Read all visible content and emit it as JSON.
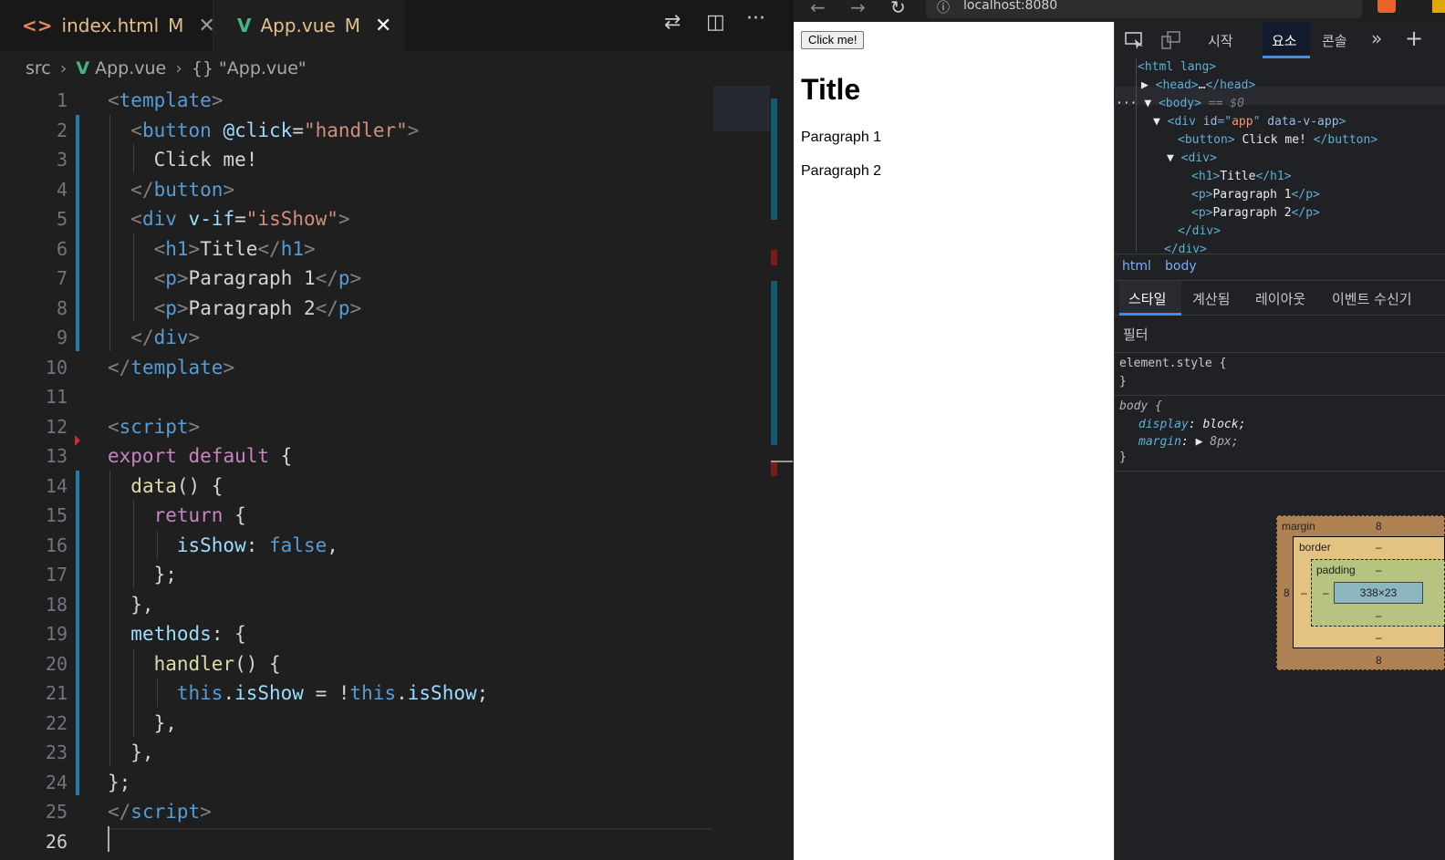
{
  "editor": {
    "tabs": [
      {
        "icon": "<>",
        "name": "index.html",
        "status": "M",
        "close": "✕"
      },
      {
        "icon": "V",
        "name": "App.vue",
        "status": "M",
        "close": "✕"
      }
    ],
    "actions": {
      "compare": "⇄",
      "split": "◫",
      "more": "···"
    },
    "breadcrumb": {
      "folder": "src",
      "file": "App.vue",
      "symbol_icon": "{}",
      "symbol": "\"App.vue\""
    },
    "line_numbers": [
      "1",
      "2",
      "3",
      "4",
      "5",
      "6",
      "7",
      "8",
      "9",
      "10",
      "11",
      "12",
      "13",
      "14",
      "15",
      "16",
      "17",
      "18",
      "19",
      "20",
      "21",
      "22",
      "23",
      "24",
      "25",
      "26"
    ],
    "code": [
      [
        {
          "t": "<",
          "c": "#808080"
        },
        {
          "t": "template",
          "c": "#569cd6"
        },
        {
          "t": ">",
          "c": "#808080"
        }
      ],
      [
        {
          "t": "  "
        },
        {
          "t": "<",
          "c": "#808080"
        },
        {
          "t": "button",
          "c": "#569cd6"
        },
        {
          "t": " "
        },
        {
          "t": "@click",
          "c": "#9cdcfe"
        },
        {
          "t": "=",
          "c": "#d4d4d4"
        },
        {
          "t": "\"handler\"",
          "c": "#ce9178"
        },
        {
          "t": ">",
          "c": "#808080"
        }
      ],
      [
        {
          "t": "    Click me!",
          "c": "#d4d4d4"
        }
      ],
      [
        {
          "t": "  "
        },
        {
          "t": "</",
          "c": "#808080"
        },
        {
          "t": "button",
          "c": "#569cd6"
        },
        {
          "t": ">",
          "c": "#808080"
        }
      ],
      [
        {
          "t": "  "
        },
        {
          "t": "<",
          "c": "#808080"
        },
        {
          "t": "div",
          "c": "#569cd6"
        },
        {
          "t": " "
        },
        {
          "t": "v-if",
          "c": "#9cdcfe"
        },
        {
          "t": "=",
          "c": "#d4d4d4"
        },
        {
          "t": "\"isShow\"",
          "c": "#ce9178"
        },
        {
          "t": ">",
          "c": "#808080"
        }
      ],
      [
        {
          "t": "    "
        },
        {
          "t": "<",
          "c": "#808080"
        },
        {
          "t": "h1",
          "c": "#569cd6"
        },
        {
          "t": ">",
          "c": "#808080"
        },
        {
          "t": "Title",
          "c": "#d4d4d4"
        },
        {
          "t": "</",
          "c": "#808080"
        },
        {
          "t": "h1",
          "c": "#569cd6"
        },
        {
          "t": ">",
          "c": "#808080"
        }
      ],
      [
        {
          "t": "    "
        },
        {
          "t": "<",
          "c": "#808080"
        },
        {
          "t": "p",
          "c": "#569cd6"
        },
        {
          "t": ">",
          "c": "#808080"
        },
        {
          "t": "Paragraph 1",
          "c": "#d4d4d4"
        },
        {
          "t": "</",
          "c": "#808080"
        },
        {
          "t": "p",
          "c": "#569cd6"
        },
        {
          "t": ">",
          "c": "#808080"
        }
      ],
      [
        {
          "t": "    "
        },
        {
          "t": "<",
          "c": "#808080"
        },
        {
          "t": "p",
          "c": "#569cd6"
        },
        {
          "t": ">",
          "c": "#808080"
        },
        {
          "t": "Paragraph 2",
          "c": "#d4d4d4"
        },
        {
          "t": "</",
          "c": "#808080"
        },
        {
          "t": "p",
          "c": "#569cd6"
        },
        {
          "t": ">",
          "c": "#808080"
        }
      ],
      [
        {
          "t": "  "
        },
        {
          "t": "</",
          "c": "#808080"
        },
        {
          "t": "div",
          "c": "#569cd6"
        },
        {
          "t": ">",
          "c": "#808080"
        }
      ],
      [
        {
          "t": "</",
          "c": "#808080"
        },
        {
          "t": "template",
          "c": "#569cd6"
        },
        {
          "t": ">",
          "c": "#808080"
        }
      ],
      [],
      [
        {
          "t": "<",
          "c": "#808080"
        },
        {
          "t": "script",
          "c": "#569cd6"
        },
        {
          "t": ">",
          "c": "#808080"
        }
      ],
      [
        {
          "t": "export",
          "c": "#c586c0"
        },
        {
          "t": " "
        },
        {
          "t": "default",
          "c": "#c586c0"
        },
        {
          "t": " {",
          "c": "#d4d4d4"
        }
      ],
      [
        {
          "t": "  "
        },
        {
          "t": "data",
          "c": "#dcdcaa"
        },
        {
          "t": "() {",
          "c": "#d4d4d4"
        }
      ],
      [
        {
          "t": "    "
        },
        {
          "t": "return",
          "c": "#c586c0"
        },
        {
          "t": " {",
          "c": "#d4d4d4"
        }
      ],
      [
        {
          "t": "      "
        },
        {
          "t": "isShow",
          "c": "#9cdcfe"
        },
        {
          "t": ": ",
          "c": "#d4d4d4"
        },
        {
          "t": "false",
          "c": "#569cd6"
        },
        {
          "t": ",",
          "c": "#d4d4d4"
        }
      ],
      [
        {
          "t": "    };",
          "c": "#d4d4d4"
        }
      ],
      [
        {
          "t": "  },",
          "c": "#d4d4d4"
        }
      ],
      [
        {
          "t": "  "
        },
        {
          "t": "methods",
          "c": "#9cdcfe"
        },
        {
          "t": ": {",
          "c": "#d4d4d4"
        }
      ],
      [
        {
          "t": "    "
        },
        {
          "t": "handler",
          "c": "#dcdcaa"
        },
        {
          "t": "() {",
          "c": "#d4d4d4"
        }
      ],
      [
        {
          "t": "      "
        },
        {
          "t": "this",
          "c": "#569cd6"
        },
        {
          "t": ".",
          "c": "#d4d4d4"
        },
        {
          "t": "isShow",
          "c": "#9cdcfe"
        },
        {
          "t": " = !",
          "c": "#d4d4d4"
        },
        {
          "t": "this",
          "c": "#569cd6"
        },
        {
          "t": ".",
          "c": "#d4d4d4"
        },
        {
          "t": "isShow",
          "c": "#9cdcfe"
        },
        {
          "t": ";",
          "c": "#d4d4d4"
        }
      ],
      [
        {
          "t": "    },",
          "c": "#d4d4d4"
        }
      ],
      [
        {
          "t": "  },",
          "c": "#d4d4d4"
        }
      ],
      [
        {
          "t": "};",
          "c": "#d4d4d4"
        }
      ],
      [
        {
          "t": "</",
          "c": "#808080"
        },
        {
          "t": "script",
          "c": "#569cd6"
        },
        {
          "t": ">",
          "c": "#808080"
        }
      ],
      []
    ]
  },
  "browser": {
    "nav": {
      "back": "←",
      "forward": "→",
      "reload": "↻",
      "info": "ⓘ"
    },
    "url": "localhost:8080",
    "page": {
      "button": "Click me!",
      "title": "Title",
      "p1": "Paragraph 1",
      "p2": "Paragraph 2"
    }
  },
  "devtools": {
    "tabs": {
      "start": "시작",
      "elements": "요소",
      "console": "콘솔",
      "more": "»",
      "add": "+"
    },
    "dom": [
      [
        {
          "t": "<html lang>",
          "c": "tg"
        }
      ],
      [
        {
          "t": "▶ ",
          "c": "tx"
        },
        {
          "t": "<head>",
          "c": "tg"
        },
        {
          "t": "…",
          "c": "tx"
        },
        {
          "t": "</head>",
          "c": "tg"
        }
      ],
      [
        {
          "t": "··· ",
          "c": "tx"
        },
        {
          "t": "▼ ",
          "c": "tx"
        },
        {
          "t": "<body>",
          "c": "tg"
        },
        {
          "t": " == $0",
          "c": "dim"
        }
      ],
      [
        {
          "t": "▼ ",
          "c": "tx"
        },
        {
          "t": "<div ",
          "c": "tg"
        },
        {
          "t": "id",
          "c": "an"
        },
        {
          "t": "=\"",
          "c": "tg"
        },
        {
          "t": "app",
          "c": "av"
        },
        {
          "t": "\" ",
          "c": "tg"
        },
        {
          "t": "data-v-app",
          "c": "an"
        },
        {
          "t": ">",
          "c": "tg"
        }
      ],
      [
        {
          "t": "<button>",
          "c": "tg"
        },
        {
          "t": " Click me! ",
          "c": "tx"
        },
        {
          "t": "</button>",
          "c": "tg"
        }
      ],
      [
        {
          "t": "▼ ",
          "c": "tx"
        },
        {
          "t": "<div>",
          "c": "tg"
        }
      ],
      [
        {
          "t": "<h1>",
          "c": "tg"
        },
        {
          "t": "Title",
          "c": "tx"
        },
        {
          "t": "</h1>",
          "c": "tg"
        }
      ],
      [
        {
          "t": "<p>",
          "c": "tg"
        },
        {
          "t": "Paragraph 1",
          "c": "tx"
        },
        {
          "t": "</p>",
          "c": "tg"
        }
      ],
      [
        {
          "t": "<p>",
          "c": "tg"
        },
        {
          "t": "Paragraph 2",
          "c": "tx"
        },
        {
          "t": "</p>",
          "c": "tg"
        }
      ],
      [
        {
          "t": "</div>",
          "c": "tg"
        }
      ],
      [
        {
          "t": "</div>",
          "c": "tg"
        }
      ]
    ],
    "crumbs": {
      "html": "html",
      "body": "body"
    },
    "styles_tabs": {
      "styles": "스타일",
      "computed": "계산됨",
      "layout": "레이아웃",
      "listeners": "이벤트 수신기"
    },
    "filter": "필터",
    "styles": {
      "element_style": "element.style {",
      "close": "}",
      "body_selector": "body {",
      "p1_name": "display",
      "p1_value": "block;",
      "p2_name": "margin",
      "p2_value": "8px;"
    },
    "box_model": {
      "margin_label": "margin",
      "margin_top": "8",
      "margin_left": "8",
      "margin_bottom": "8",
      "border_label": "border",
      "border_top": "–",
      "border_left": "–",
      "border_bottom": "–",
      "padding_label": "padding",
      "padding_top": "–",
      "padding_left": "–",
      "padding_bottom": "–",
      "content": "338×23"
    }
  }
}
